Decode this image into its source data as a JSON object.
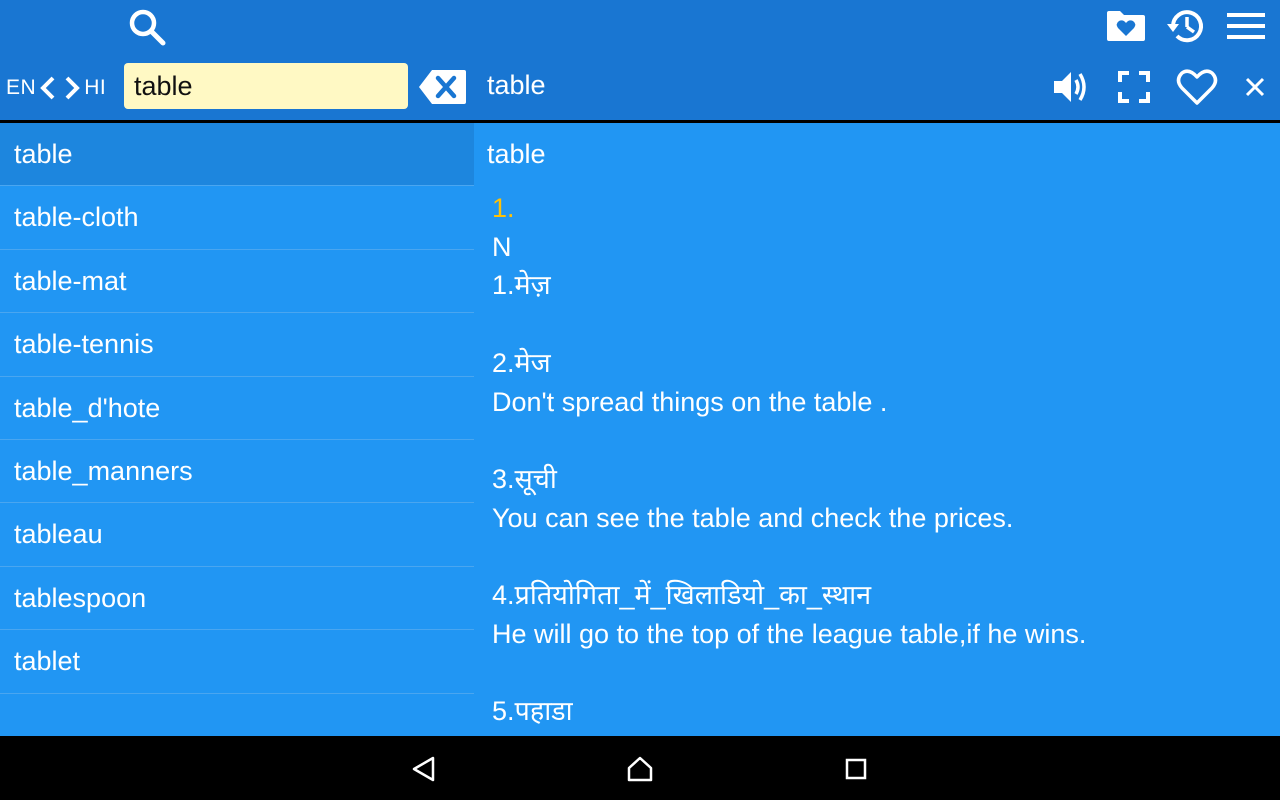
{
  "toolbar": {
    "icons": {
      "search": "search-icon",
      "favorites_folder": "favorites-folder-icon",
      "history": "history-icon",
      "menu": "menu-icon"
    }
  },
  "language": {
    "source": "EN",
    "target": "HI"
  },
  "search": {
    "value": "table",
    "clear_icon": "backspace-clear-icon"
  },
  "header": {
    "word": "table",
    "icons": [
      "volume-icon",
      "fullscreen-icon",
      "heart-icon",
      "close-icon"
    ]
  },
  "word_list": [
    "table",
    "table-cloth",
    "table-mat",
    "table-tennis",
    "table_d'hote",
    "table_manners",
    "tableau",
    "tablespoon",
    "tablet"
  ],
  "selected_index": 0,
  "entry": {
    "title": "table",
    "sense_number": "1.",
    "pos": "N",
    "definitions": [
      {
        "hi": "1.मेज़",
        "example": ""
      },
      {
        "hi": "2.मेज",
        "example": "Don't spread things on the table ."
      },
      {
        "hi": "3.सूची",
        "example": "You can see the table and check the prices."
      },
      {
        "hi": "4.प्रतियोगिता_में_खिलाडियो_का_स्थान",
        "example": "He will go to the top of the league table,if he wins."
      },
      {
        "hi": "5.पहाडा",
        "example": ""
      }
    ]
  },
  "navbar": {
    "icons": [
      "back-icon",
      "home-icon",
      "recents-icon"
    ]
  },
  "colors": {
    "toolbar": "#1976d2",
    "panel": "#2196f3",
    "selected_row": "#1d86de",
    "search_bg": "#fff9c4",
    "sense_number": "#ffc107"
  }
}
